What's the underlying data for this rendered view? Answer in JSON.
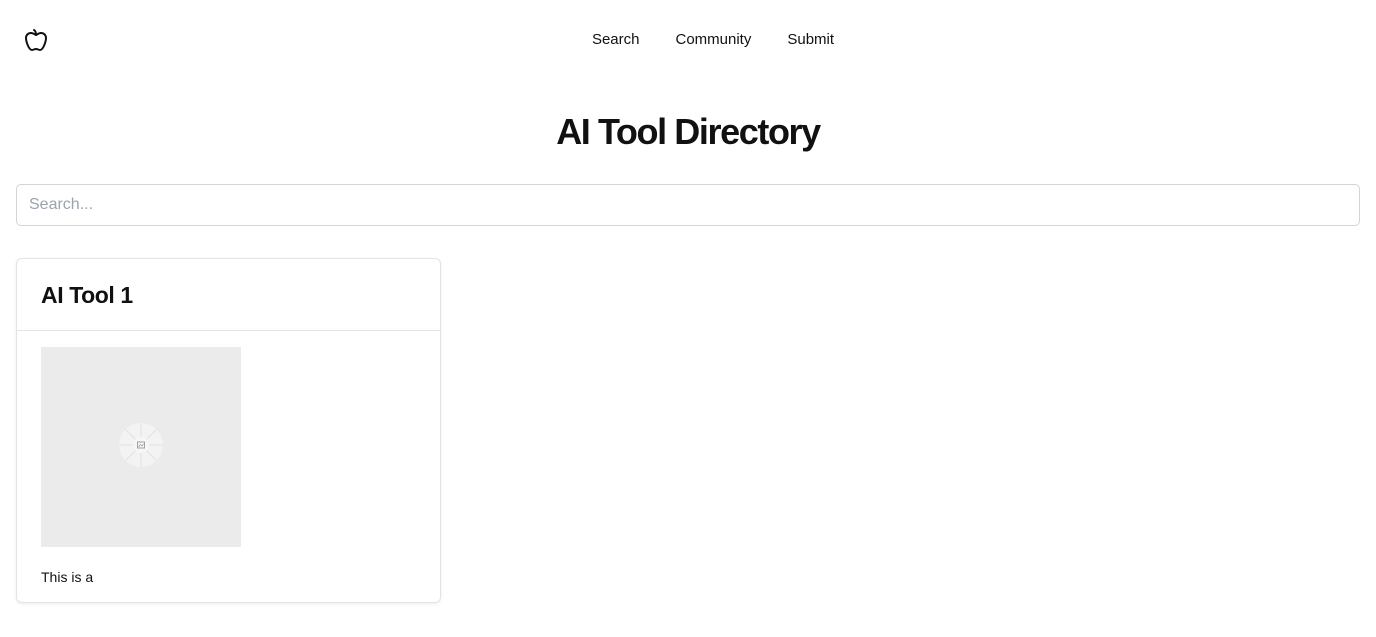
{
  "nav": {
    "logo_icon": "apple-icon",
    "items": [
      {
        "label": "Search"
      },
      {
        "label": "Community"
      },
      {
        "label": "Submit"
      }
    ]
  },
  "page": {
    "title": "AI Tool Directory"
  },
  "search": {
    "placeholder": "Search...",
    "value": ""
  },
  "tools": [
    {
      "title": "AI Tool 1",
      "image_icon": "broken-image-icon",
      "description": "This is a"
    }
  ]
}
